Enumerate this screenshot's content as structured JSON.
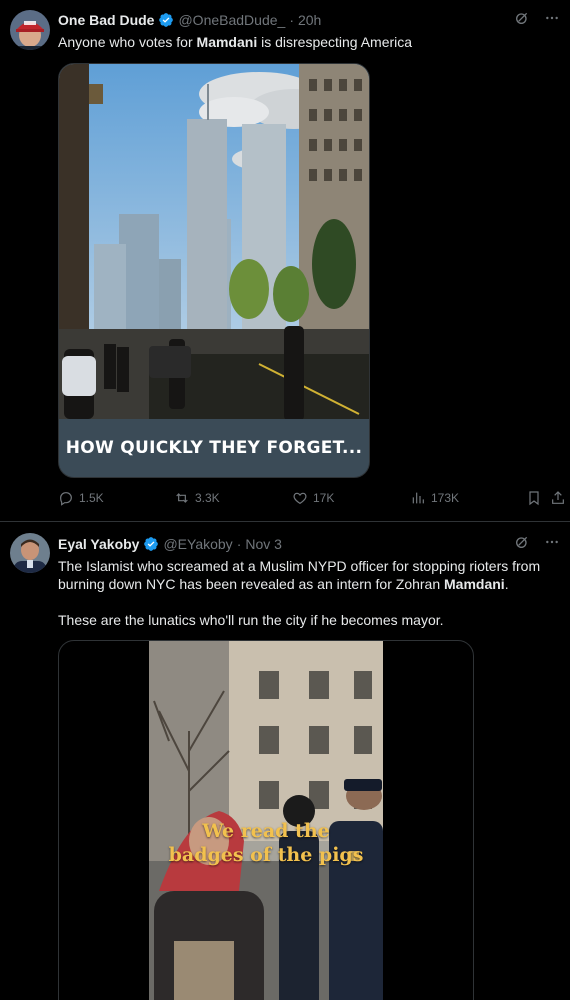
{
  "tweets": [
    {
      "name": "One Bad Dude",
      "handle": "@OneBadDude_",
      "time": "20h",
      "text_pre": "Anyone who votes for ",
      "text_bold": "Mamdani",
      "text_post": " is disrespecting America",
      "media_caption": "HOW QUICKLY THEY FORGET...",
      "stats": {
        "replies": "1.5K",
        "reposts": "3.3K",
        "likes": "17K",
        "views": "173K"
      }
    },
    {
      "name": "Eyal Yakoby",
      "handle": "@EYakoby",
      "time": "Nov 3",
      "text_pre": "The Islamist who screamed at a Muslim NYPD officer for stopping rioters from burning down NYC has been revealed as an intern for Zohran ",
      "text_bold": "Mamdani",
      "text_post": ".",
      "text_para2": "These are the lunatics who'll run the city if he becomes mayor.",
      "video_overlay_line1": "We read the",
      "video_overlay_line2": "badges of the pigs"
    }
  ],
  "icons": {
    "verified": "verified-badge-icon",
    "grok": "grok-icon",
    "more": "more-icon",
    "reply": "reply-icon",
    "repost": "repost-icon",
    "like": "like-icon",
    "views": "views-icon",
    "bookmark": "bookmark-icon",
    "share": "share-icon"
  },
  "colors": {
    "background": "#000000",
    "text": "#e7e9ea",
    "secondary": "#71767b",
    "verified": "#1d9bf0",
    "divider": "#2f3336",
    "overlay_text": "#f2c14e"
  }
}
